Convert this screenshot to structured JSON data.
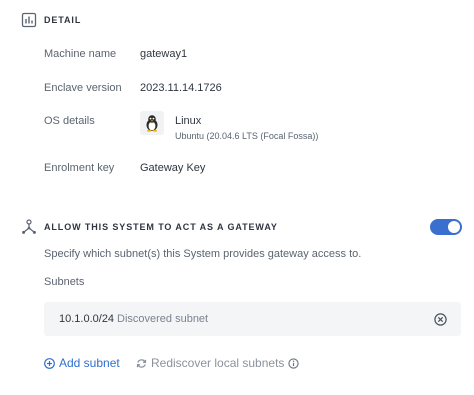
{
  "detail": {
    "title": "DETAIL",
    "icon": "bar-chart-icon",
    "machine_name_label": "Machine name",
    "machine_name_value": "gateway1",
    "enclave_version_label": "Enclave version",
    "enclave_version_value": "2023.11.14.1726",
    "os_details_label": "OS details",
    "os_name": "Linux",
    "os_version": "Ubuntu (20.04.6 LTS (Focal Fossa))",
    "os_icon": "linux-penguin-icon",
    "enrolment_key_label": "Enrolment key",
    "enrolment_key_value": "Gateway Key"
  },
  "gateway": {
    "title": "ALLOW THIS SYSTEM TO ACT AS A GATEWAY",
    "icon": "network-gateway-icon",
    "toggle_on": true,
    "description": "Specify which subnet(s) this System provides gateway access to.",
    "subnets_label": "Subnets",
    "subnets": [
      {
        "cidr": "10.1.0.0/24",
        "tag": "Discovered subnet"
      }
    ],
    "add_subnet_label": "Add subnet",
    "rediscover_label": "Rediscover local subnets"
  },
  "colors": {
    "accent": "#3a6fd0",
    "link": "#2f6fce",
    "muted": "#8b929c",
    "row_background": "#f4f5f7"
  }
}
